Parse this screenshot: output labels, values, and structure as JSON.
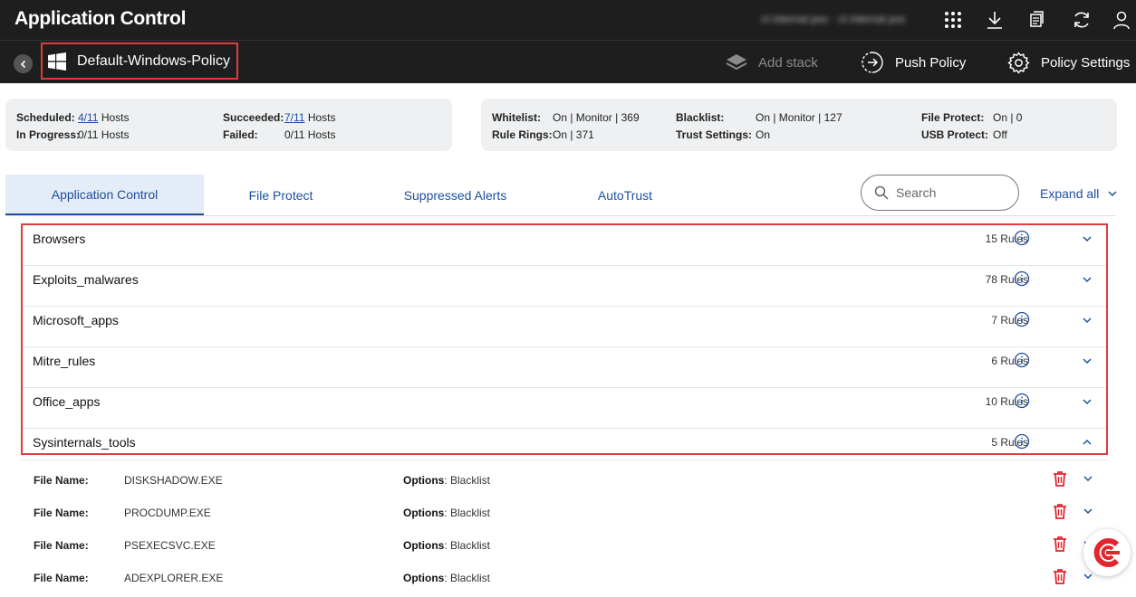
{
  "app": {
    "title": "Application Control",
    "account": "ct internal poc · ct internal poc"
  },
  "policy": {
    "name": "Default-Windows-Policy"
  },
  "actions": {
    "add_stack": "Add stack",
    "push_policy": "Push Policy",
    "policy_settings": "Policy Settings"
  },
  "status": {
    "scheduled_label": "Scheduled:",
    "scheduled_value": "4/11",
    "scheduled_unit": "Hosts",
    "succeeded_label": "Succeeded:",
    "succeeded_value": "7/11",
    "succeeded_unit": "Hosts",
    "in_progress_label": "In Progress:",
    "in_progress_value": "0/11 Hosts",
    "failed_label": "Failed:",
    "failed_value": "0/11 Hosts"
  },
  "settings": {
    "whitelist_label": "Whitelist:",
    "whitelist_value": "On  |  Monitor |  369",
    "blacklist_label": "Blacklist:",
    "blacklist_value": "On  |  Monitor  |  127",
    "file_protect_label": "File Protect:",
    "file_protect_value": "On  |  0",
    "rule_rings_label": "Rule Rings:",
    "rule_rings_value": "On  |  371",
    "trust_settings_label": "Trust Settings:",
    "trust_settings_value": "On",
    "usb_protect_label": "USB Protect:",
    "usb_protect_value": "Off"
  },
  "tabs": [
    {
      "label": "Application Control"
    },
    {
      "label": "File Protect"
    },
    {
      "label": "Suppressed Alerts"
    },
    {
      "label": "AutoTrust"
    }
  ],
  "search": {
    "placeholder": "Search"
  },
  "expand_all": "Expand all",
  "rule_groups": [
    {
      "name": "Browsers",
      "count": "15 Rules"
    },
    {
      "name": "Exploits_malwares",
      "count": "78 Rules"
    },
    {
      "name": "Microsoft_apps",
      "count": "7 Rules"
    },
    {
      "name": "Mitre_rules",
      "count": "6 Rules"
    },
    {
      "name": "Office_apps",
      "count": "10 Rules"
    },
    {
      "name": "Sysinternals_tools",
      "count": "5 Rules"
    }
  ],
  "file_label": "File Name:",
  "options_label": "Options",
  "files": [
    {
      "name": "DISKSHADOW.EXE",
      "option": ": Blacklist"
    },
    {
      "name": "PROCDUMP.EXE",
      "option": ": Blacklist"
    },
    {
      "name": "PSEXECSVC.EXE",
      "option": ": Blacklist"
    },
    {
      "name": "ADEXPLORER.EXE",
      "option": ": Blacklist"
    }
  ],
  "colors": {
    "accent": "#1d4f9e",
    "danger": "#e3262e",
    "highlight": "#e33b3b",
    "topbar": "#1e1e1e"
  }
}
